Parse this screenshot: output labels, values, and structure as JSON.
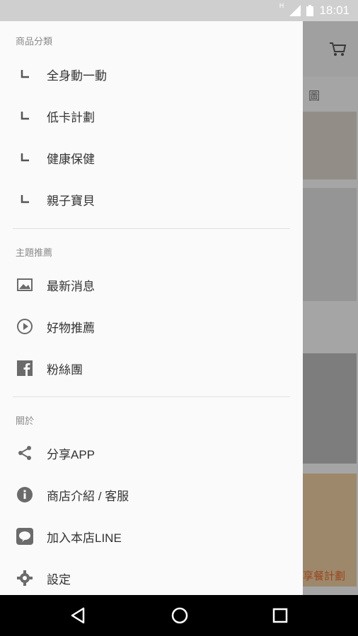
{
  "status_bar": {
    "time": "18:01",
    "signal_label": "H"
  },
  "drawer": {
    "sections": [
      {
        "title": "商品分類"
      },
      {
        "title": "主題推薦"
      },
      {
        "title": "關於"
      }
    ],
    "categories": [
      {
        "label": "全身動一動",
        "icon": "subitem-corner-icon"
      },
      {
        "label": "低卡計劃",
        "icon": "subitem-corner-icon"
      },
      {
        "label": "健康保健",
        "icon": "subitem-corner-icon"
      },
      {
        "label": "親子寶貝",
        "icon": "subitem-corner-icon"
      }
    ],
    "topics": [
      {
        "label": "最新消息",
        "icon": "image-icon"
      },
      {
        "label": "好物推薦",
        "icon": "play-circle-icon"
      },
      {
        "label": "粉絲團",
        "icon": "facebook-icon"
      }
    ],
    "about": [
      {
        "label": "分享APP",
        "icon": "share-icon"
      },
      {
        "label": "商店介紹 / 客服",
        "icon": "info-icon"
      },
      {
        "label": "加入本店LINE",
        "icon": "line-icon"
      },
      {
        "label": "設定",
        "icon": "gear-icon"
      }
    ]
  },
  "background": {
    "partial_label_1": "圖",
    "partial_label_2": "享餐計劃"
  },
  "colors": {
    "accent": "#e06a2c",
    "icon_gray": "#6b6b6b",
    "status_bar": "#cfcfcf"
  }
}
